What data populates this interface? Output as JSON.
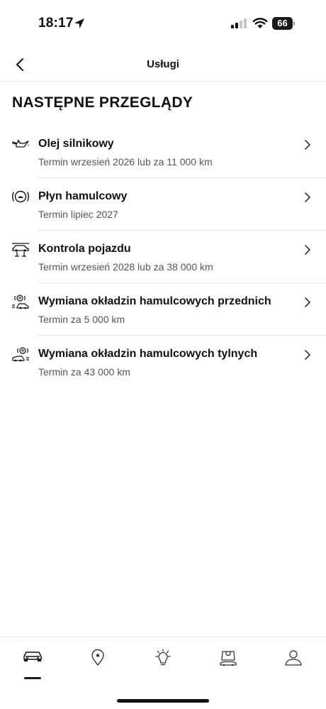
{
  "status_bar": {
    "time": "18:17",
    "battery": "66"
  },
  "nav": {
    "title": "Usługi"
  },
  "section": {
    "title": "NASTĘPNE PRZEGLĄDY"
  },
  "services": [
    {
      "title": "Olej silnikowy",
      "subtitle": "Termin wrzesień 2026 lub za 11 000 km",
      "icon": "oil-can-icon"
    },
    {
      "title": "Płyn hamulcowy",
      "subtitle": "Termin lipiec 2027",
      "icon": "brake-fluid-icon"
    },
    {
      "title": "Kontrola pojazdu",
      "subtitle": "Termin wrzesień 2028 lub za 38 000 km",
      "icon": "car-lift-icon"
    },
    {
      "title": "Wymiana okładzin hamulcowych przednich",
      "subtitle": "Termin za 5 000 km",
      "icon": "front-brake-pads-icon"
    },
    {
      "title": "Wymiana okładzin hamulcowych tylnych",
      "subtitle": "Termin za 43 000 km",
      "icon": "rear-brake-pads-icon"
    }
  ],
  "tabs": [
    {
      "icon": "car-icon",
      "active": true
    },
    {
      "icon": "map-pin-icon",
      "active": false
    },
    {
      "icon": "lightbulb-icon",
      "active": false
    },
    {
      "icon": "shop-bag-icon",
      "active": false
    },
    {
      "icon": "profile-icon",
      "active": false
    }
  ],
  "colors": {
    "text": "#111111",
    "subtext": "#555555",
    "divider": "#e4e4e4"
  }
}
